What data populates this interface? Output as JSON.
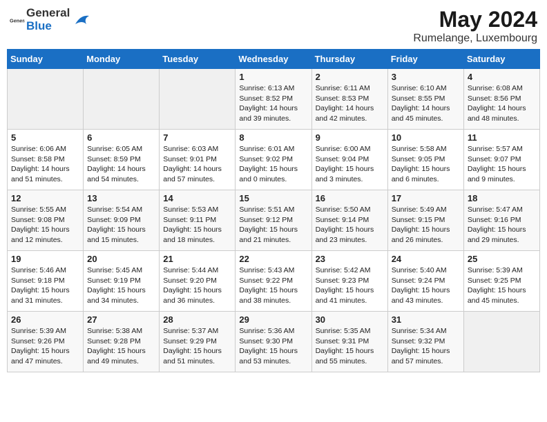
{
  "header": {
    "logo_general": "General",
    "logo_blue": "Blue",
    "title": "May 2024",
    "location": "Rumelange, Luxembourg"
  },
  "days_of_week": [
    "Sunday",
    "Monday",
    "Tuesday",
    "Wednesday",
    "Thursday",
    "Friday",
    "Saturday"
  ],
  "weeks": [
    [
      {
        "day": "",
        "info": ""
      },
      {
        "day": "",
        "info": ""
      },
      {
        "day": "",
        "info": ""
      },
      {
        "day": "1",
        "info": "Sunrise: 6:13 AM\nSunset: 8:52 PM\nDaylight: 14 hours and 39 minutes."
      },
      {
        "day": "2",
        "info": "Sunrise: 6:11 AM\nSunset: 8:53 PM\nDaylight: 14 hours and 42 minutes."
      },
      {
        "day": "3",
        "info": "Sunrise: 6:10 AM\nSunset: 8:55 PM\nDaylight: 14 hours and 45 minutes."
      },
      {
        "day": "4",
        "info": "Sunrise: 6:08 AM\nSunset: 8:56 PM\nDaylight: 14 hours and 48 minutes."
      }
    ],
    [
      {
        "day": "5",
        "info": "Sunrise: 6:06 AM\nSunset: 8:58 PM\nDaylight: 14 hours and 51 minutes."
      },
      {
        "day": "6",
        "info": "Sunrise: 6:05 AM\nSunset: 8:59 PM\nDaylight: 14 hours and 54 minutes."
      },
      {
        "day": "7",
        "info": "Sunrise: 6:03 AM\nSunset: 9:01 PM\nDaylight: 14 hours and 57 minutes."
      },
      {
        "day": "8",
        "info": "Sunrise: 6:01 AM\nSunset: 9:02 PM\nDaylight: 15 hours and 0 minutes."
      },
      {
        "day": "9",
        "info": "Sunrise: 6:00 AM\nSunset: 9:04 PM\nDaylight: 15 hours and 3 minutes."
      },
      {
        "day": "10",
        "info": "Sunrise: 5:58 AM\nSunset: 9:05 PM\nDaylight: 15 hours and 6 minutes."
      },
      {
        "day": "11",
        "info": "Sunrise: 5:57 AM\nSunset: 9:07 PM\nDaylight: 15 hours and 9 minutes."
      }
    ],
    [
      {
        "day": "12",
        "info": "Sunrise: 5:55 AM\nSunset: 9:08 PM\nDaylight: 15 hours and 12 minutes."
      },
      {
        "day": "13",
        "info": "Sunrise: 5:54 AM\nSunset: 9:09 PM\nDaylight: 15 hours and 15 minutes."
      },
      {
        "day": "14",
        "info": "Sunrise: 5:53 AM\nSunset: 9:11 PM\nDaylight: 15 hours and 18 minutes."
      },
      {
        "day": "15",
        "info": "Sunrise: 5:51 AM\nSunset: 9:12 PM\nDaylight: 15 hours and 21 minutes."
      },
      {
        "day": "16",
        "info": "Sunrise: 5:50 AM\nSunset: 9:14 PM\nDaylight: 15 hours and 23 minutes."
      },
      {
        "day": "17",
        "info": "Sunrise: 5:49 AM\nSunset: 9:15 PM\nDaylight: 15 hours and 26 minutes."
      },
      {
        "day": "18",
        "info": "Sunrise: 5:47 AM\nSunset: 9:16 PM\nDaylight: 15 hours and 29 minutes."
      }
    ],
    [
      {
        "day": "19",
        "info": "Sunrise: 5:46 AM\nSunset: 9:18 PM\nDaylight: 15 hours and 31 minutes."
      },
      {
        "day": "20",
        "info": "Sunrise: 5:45 AM\nSunset: 9:19 PM\nDaylight: 15 hours and 34 minutes."
      },
      {
        "day": "21",
        "info": "Sunrise: 5:44 AM\nSunset: 9:20 PM\nDaylight: 15 hours and 36 minutes."
      },
      {
        "day": "22",
        "info": "Sunrise: 5:43 AM\nSunset: 9:22 PM\nDaylight: 15 hours and 38 minutes."
      },
      {
        "day": "23",
        "info": "Sunrise: 5:42 AM\nSunset: 9:23 PM\nDaylight: 15 hours and 41 minutes."
      },
      {
        "day": "24",
        "info": "Sunrise: 5:40 AM\nSunset: 9:24 PM\nDaylight: 15 hours and 43 minutes."
      },
      {
        "day": "25",
        "info": "Sunrise: 5:39 AM\nSunset: 9:25 PM\nDaylight: 15 hours and 45 minutes."
      }
    ],
    [
      {
        "day": "26",
        "info": "Sunrise: 5:39 AM\nSunset: 9:26 PM\nDaylight: 15 hours and 47 minutes."
      },
      {
        "day": "27",
        "info": "Sunrise: 5:38 AM\nSunset: 9:28 PM\nDaylight: 15 hours and 49 minutes."
      },
      {
        "day": "28",
        "info": "Sunrise: 5:37 AM\nSunset: 9:29 PM\nDaylight: 15 hours and 51 minutes."
      },
      {
        "day": "29",
        "info": "Sunrise: 5:36 AM\nSunset: 9:30 PM\nDaylight: 15 hours and 53 minutes."
      },
      {
        "day": "30",
        "info": "Sunrise: 5:35 AM\nSunset: 9:31 PM\nDaylight: 15 hours and 55 minutes."
      },
      {
        "day": "31",
        "info": "Sunrise: 5:34 AM\nSunset: 9:32 PM\nDaylight: 15 hours and 57 minutes."
      },
      {
        "day": "",
        "info": ""
      }
    ]
  ]
}
